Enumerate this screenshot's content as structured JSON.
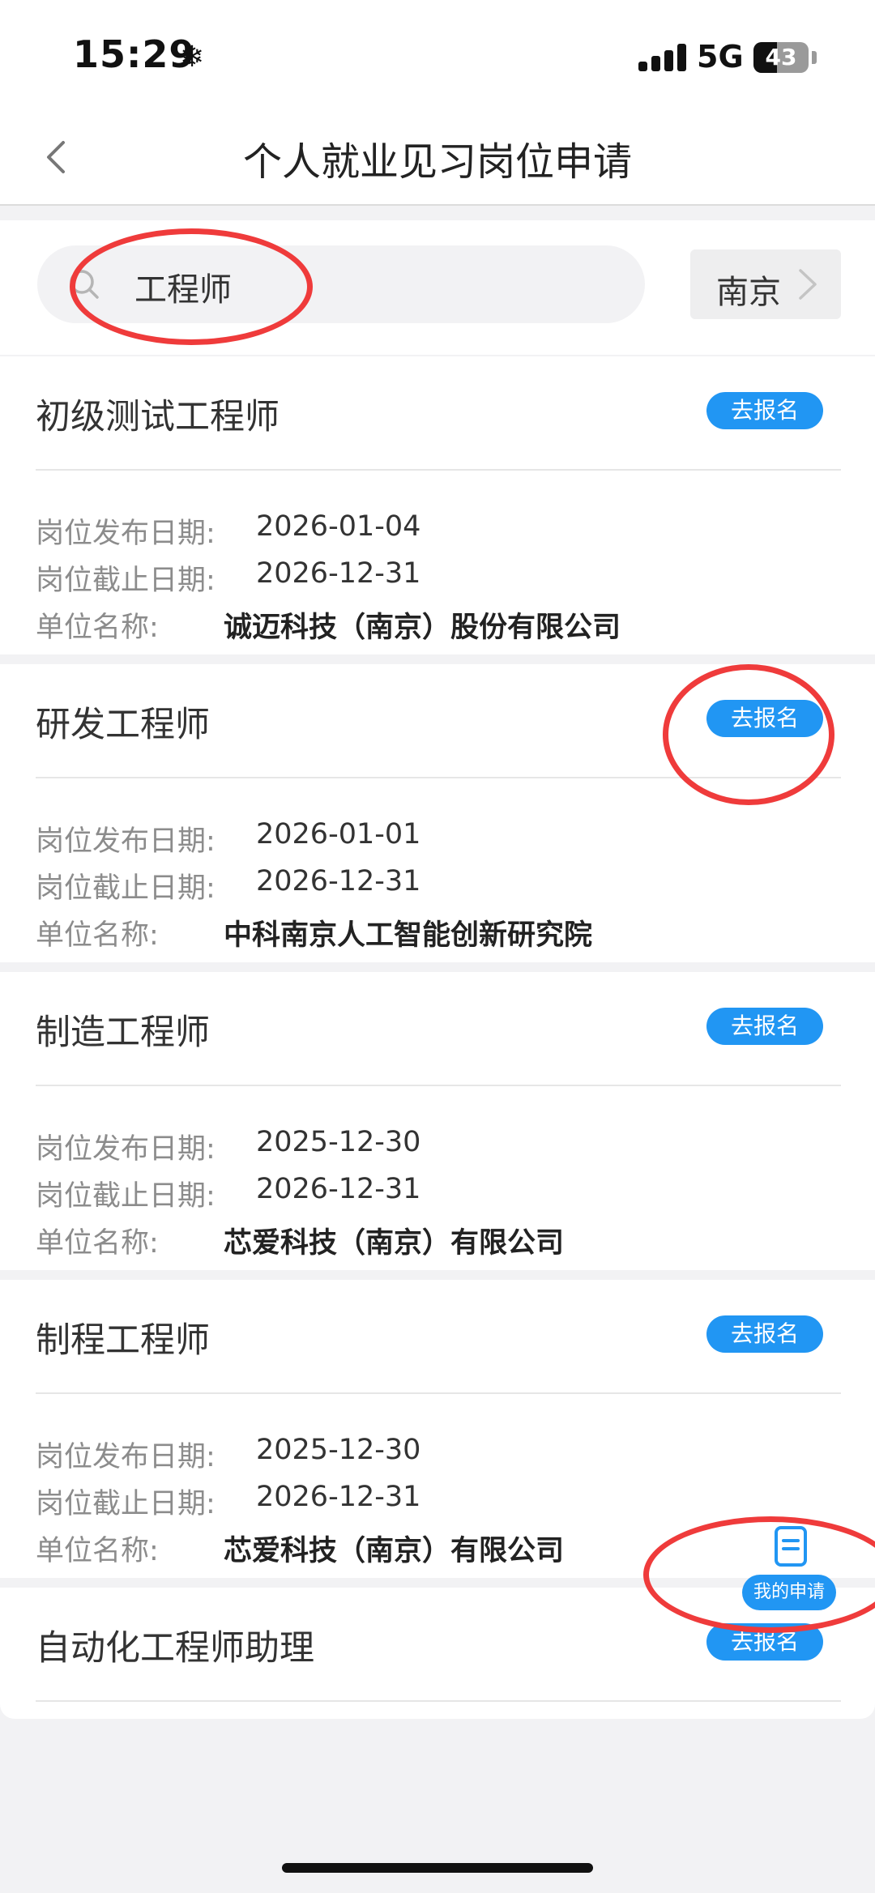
{
  "status_bar": {
    "time": "15:29",
    "network": "5G",
    "battery": "43",
    "battery_level": 0.43,
    "icons": [
      "snowflake-icon",
      "signal-icon",
      "battery-icon"
    ]
  },
  "nav": {
    "title": "个人就业见习岗位申请",
    "back_icon": "chevron-left-icon"
  },
  "search": {
    "query": "工程师",
    "icon": "search-icon",
    "city": "南京",
    "city_icon": "chevron-right-icon"
  },
  "labels": {
    "publish_date": "岗位发布日期:",
    "deadline": "岗位截止日期:",
    "company": "单位名称:",
    "apply": "去报名"
  },
  "jobs": [
    {
      "title": "初级测试工程师",
      "publish_date": "2026-01-04",
      "deadline": "2026-12-31",
      "company": "诚迈科技（南京）股份有限公司"
    },
    {
      "title": "研发工程师",
      "publish_date": "2026-01-01",
      "deadline": "2026-12-31",
      "company": "中科南京人工智能创新研究院"
    },
    {
      "title": "制造工程师",
      "publish_date": "2025-12-30",
      "deadline": "2026-12-31",
      "company": "芯爱科技（南京）有限公司"
    },
    {
      "title": "制程工程师",
      "publish_date": "2025-12-30",
      "deadline": "2026-12-31",
      "company": "芯爱科技（南京）有限公司"
    },
    {
      "title": "自动化工程师助理"
    }
  ],
  "floating": {
    "label": "我的申请",
    "icon": "document-icon"
  },
  "colors": {
    "accent": "#2196f3",
    "annotation": "#ef3b3b",
    "background": "#f2f2f4"
  }
}
